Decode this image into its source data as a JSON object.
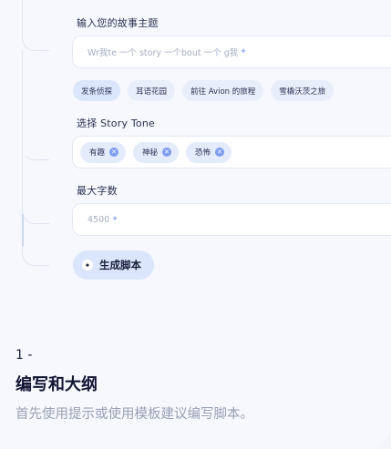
{
  "form": {
    "topic_label": "输入您的故事主题",
    "topic_placeholder": "Wr我te 一个 story 一个bout 一个 g我",
    "suggestions": [
      "发条侦探",
      "耳语花园",
      "前往 Avion 的旅程",
      "雪橇沃茨之旅"
    ],
    "tone_label": "选择 Story Tone",
    "tones": [
      "有趣",
      "神秘",
      "恐怖"
    ],
    "words_label": "最大字数",
    "words_placeholder": "4500",
    "generate_label": "生成脚本"
  },
  "step": {
    "number": "1 -",
    "title": "编写和大纲",
    "description": "首先使用提示或使用模板建议编写脚本。"
  },
  "colors": {
    "accent": "#7f9df0",
    "chip_bg": "#e9eefb",
    "button_bg": "#dbe6fd"
  }
}
